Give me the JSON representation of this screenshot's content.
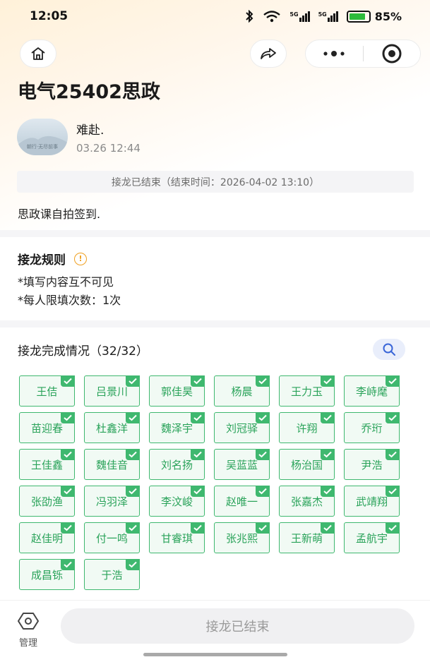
{
  "status_bar": {
    "time": "12:05",
    "signal1": "5G",
    "signal2": "5G",
    "battery_percent": "85%",
    "battery_level": 0.85
  },
  "nav": {
    "home_icon": "home-icon",
    "share_icon": "share-icon",
    "more_icon": "more-dots-icon",
    "close_icon": "target-close-icon"
  },
  "page": {
    "title": "电气25402思政",
    "author_name": "难赴.",
    "author_time": "03.26 12:44",
    "avatar_text": "朝行·无尽前事",
    "end_banner": "接龙已结束（结束时间：2026-04-02 13:10）",
    "description": "思政课自拍签到."
  },
  "rules": {
    "title": "接龙规则",
    "items": [
      "*填写内容互不可见",
      "*每人限填次数：1次"
    ]
  },
  "progress": {
    "title": "接龙完成情况（32/32）",
    "names": [
      "王佶",
      "吕景川",
      "郭佳昊",
      "杨晨",
      "王力玉",
      "李峙麾",
      "苗迎春",
      "杜鑫洋",
      "魏泽宇",
      "刘冠驿",
      "许翔",
      "乔珩",
      "王佳鑫",
      "魏佳音",
      "刘名扬",
      "吴蓝蓝",
      "杨治国",
      "尹浩",
      "张劭渔",
      "冯羽泽",
      "李汶峻",
      "赵唯一",
      "张嘉杰",
      "武靖翔",
      "赵佳明",
      "付一鸣",
      "甘睿琪",
      "张兆熙",
      "王新萌",
      "孟航宇",
      "成昌铄",
      "于浩"
    ]
  },
  "bottom": {
    "manage_label": "管理",
    "ended_button": "接龙已结束"
  },
  "colors": {
    "accent_green": "#3fb86f",
    "warning": "#f0a020"
  }
}
